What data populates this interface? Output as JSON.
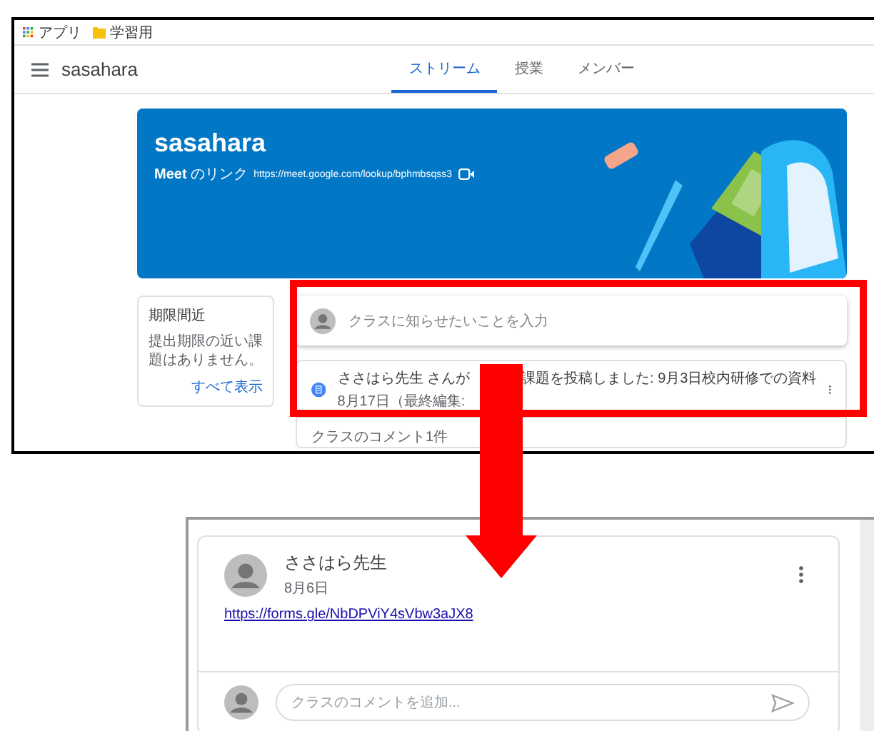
{
  "top_screenshot": {
    "bookmarks": [
      {
        "label": "アプリ",
        "kind": "apps"
      },
      {
        "label": "学習用",
        "kind": "folder"
      }
    ],
    "header": {
      "title": "sasahara",
      "tabs": [
        {
          "label": "ストリーム",
          "selected": true
        },
        {
          "label": "授業",
          "selected": false
        },
        {
          "label": "メンバー",
          "selected": false
        }
      ]
    },
    "banner": {
      "title": "sasahara",
      "meet_label": "**Meet** のリンク",
      "meet_link": "https://meet.google.com/lookup/bphmbsqss3"
    },
    "upcoming": {
      "title": "期限間近",
      "message": "提出期限の近い課題はありません。",
      "link": "すべて表示"
    },
    "announce": {
      "placeholder": "クラスに知らせたいことを入力"
    },
    "post": {
      "title_before": "ささはら先生 さんが",
      "title_after": "課題を投稿しました: 9月3日校内研修での資料",
      "date": "8月17日（最終編集:"
    },
    "comments_count": "クラスのコメント1件"
  },
  "bottom_screenshot": {
    "author": "ささはら先生",
    "date": "8月6日",
    "link": "https://forms.gle/NbDPViY4sVbw3aJX8",
    "comment": {
      "placeholder": "クラスのコメントを追加..."
    }
  }
}
